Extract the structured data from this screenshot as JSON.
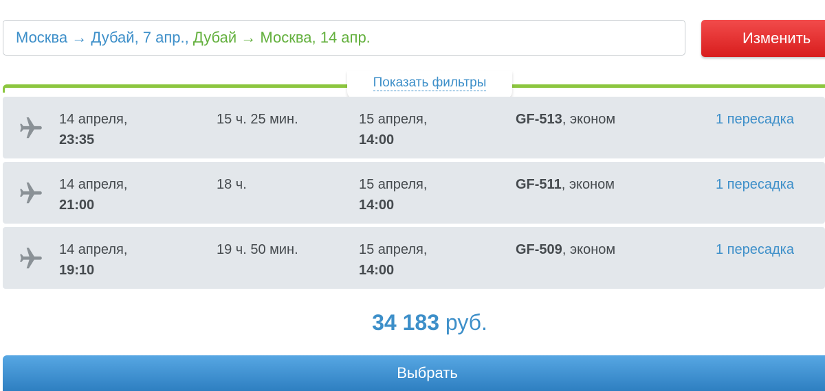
{
  "search": {
    "outbound": "Москва → Дубай, 7 апр.",
    "separator": ",",
    "return": "Дубай → Москва, 14 апр.",
    "change_label": "Изменить"
  },
  "filters": {
    "toggle_label": "Показать фильтры"
  },
  "flights": [
    {
      "dep_date": "14 апреля,",
      "dep_time": "23:35",
      "duration": "15 ч. 25 мин.",
      "arr_date": "15 апреля,",
      "arr_time": "14:00",
      "flight_no": "GF-513",
      "cabin": ", эконом",
      "stops": "1 пересадка"
    },
    {
      "dep_date": "14 апреля,",
      "dep_time": "21:00",
      "duration": "18 ч.",
      "arr_date": "15 апреля,",
      "arr_time": "14:00",
      "flight_no": "GF-511",
      "cabin": ", эконом",
      "stops": "1 пересадка"
    },
    {
      "dep_date": "14 апреля,",
      "dep_time": "19:10",
      "duration": "19 ч. 50 мин.",
      "arr_date": "15 апреля,",
      "arr_time": "14:00",
      "flight_no": "GF-509",
      "cabin": ", эконом",
      "stops": "1 пересадка"
    }
  ],
  "price": {
    "amount": "34 183",
    "currency": " руб."
  },
  "select_label": "Выбрать",
  "icons": {
    "flight": "airplane-icon"
  },
  "colors": {
    "link": "#3d8fc9",
    "return_route": "#63b03d",
    "change_button": "#e02b2b",
    "select_button": "#3d8fd0",
    "filter_accent": "#8cc63f"
  }
}
